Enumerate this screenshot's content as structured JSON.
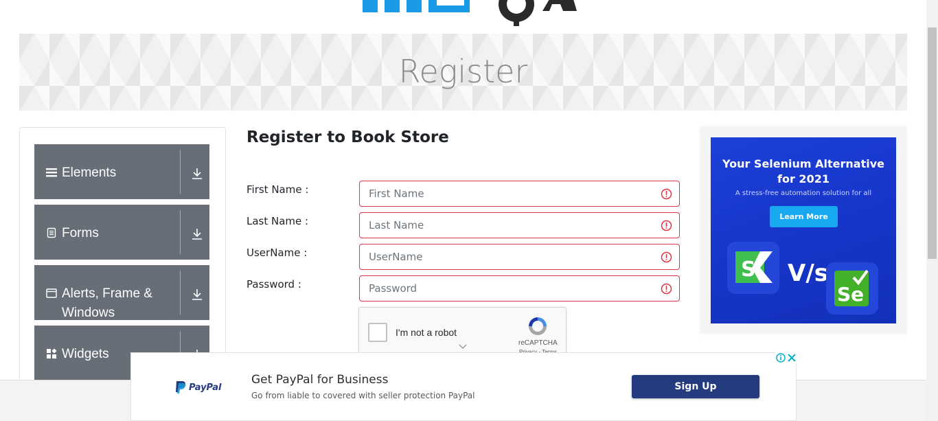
{
  "banner": {
    "title": "Register"
  },
  "menu": [
    {
      "label": "Elements",
      "icon": "hamburger-icon"
    },
    {
      "label": "Forms",
      "icon": "document-icon"
    },
    {
      "label": "Alerts, Frame & Windows",
      "icon": "window-icon"
    },
    {
      "label": "Widgets",
      "icon": "widgets-icon"
    }
  ],
  "form": {
    "title": "Register to Book Store",
    "fields": [
      {
        "label": "First Name :",
        "placeholder": "First Name"
      },
      {
        "label": "Last Name :",
        "placeholder": "Last Name"
      },
      {
        "label": "UserName :",
        "placeholder": "UserName"
      },
      {
        "label": "Password :",
        "placeholder": "Password"
      }
    ],
    "captcha": {
      "label": "I'm not a robot",
      "brand": "reCAPTCHA",
      "links": "Privacy - Terms"
    }
  },
  "side_ad": {
    "title_line1": "Your Selenium Alternative",
    "title_line2": "for 2021",
    "subtitle": "A stress-free automation solution for all",
    "button": "Learn More",
    "vs": "V/s"
  },
  "bottom_ad": {
    "brand": "PayPal",
    "title": "Get PayPal for Business",
    "description": "Go from liable to covered with seller protection PayPal",
    "button": "Sign Up"
  },
  "colors": {
    "menu_bg": "#676e77",
    "error_border": "#dc3545",
    "ad_blue": "#1736c9",
    "paypal_button": "#253b80"
  }
}
